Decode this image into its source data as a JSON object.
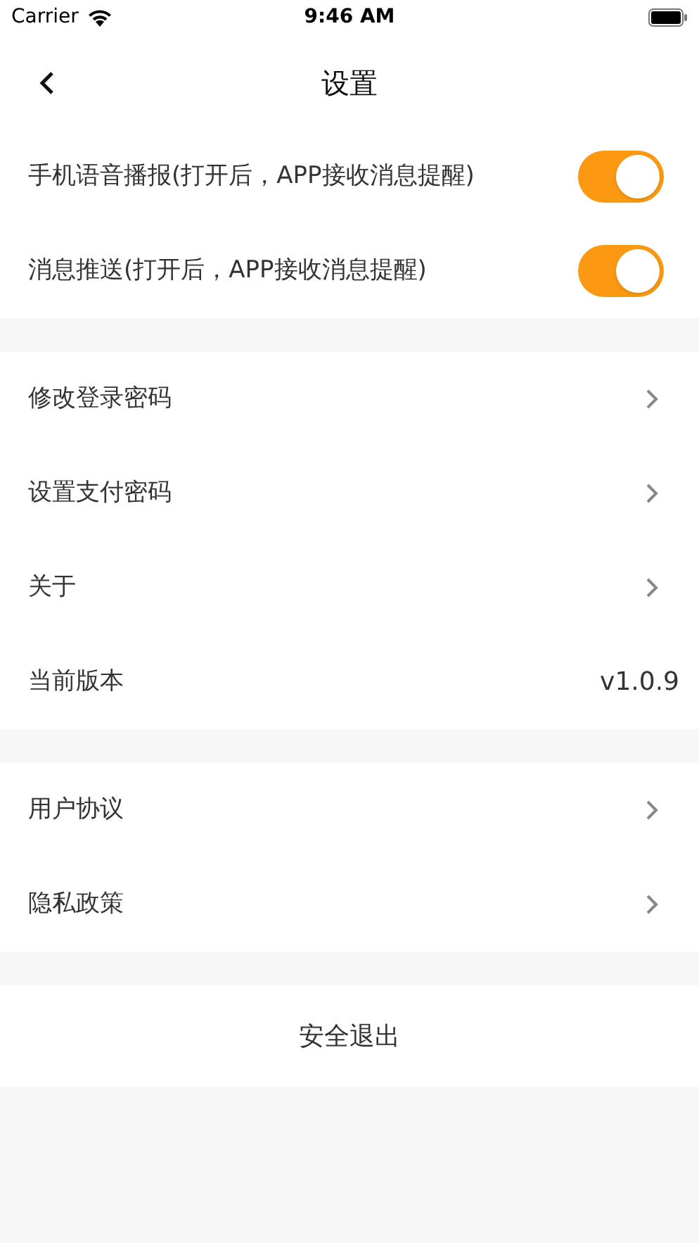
{
  "status_bar": {
    "carrier": "Carrier",
    "time": "9:46 AM"
  },
  "nav": {
    "title": "设置"
  },
  "sections": [
    {
      "items": [
        {
          "kind": "toggle",
          "label": "手机语音播报(打开后，APP接收消息提醒)",
          "on": true
        },
        {
          "kind": "toggle",
          "label": "消息推送(打开后，APP接收消息提醒)",
          "on": true
        }
      ]
    },
    {
      "items": [
        {
          "kind": "link",
          "label": "修改登录密码"
        },
        {
          "kind": "link",
          "label": "设置支付密码"
        },
        {
          "kind": "link",
          "label": "关于"
        },
        {
          "kind": "value",
          "label": "当前版本",
          "value": "v1.0.9"
        }
      ]
    },
    {
      "items": [
        {
          "kind": "link",
          "label": "用户协议"
        },
        {
          "kind": "link",
          "label": "隐私政策"
        }
      ]
    }
  ],
  "logout": {
    "label": "安全退出"
  }
}
